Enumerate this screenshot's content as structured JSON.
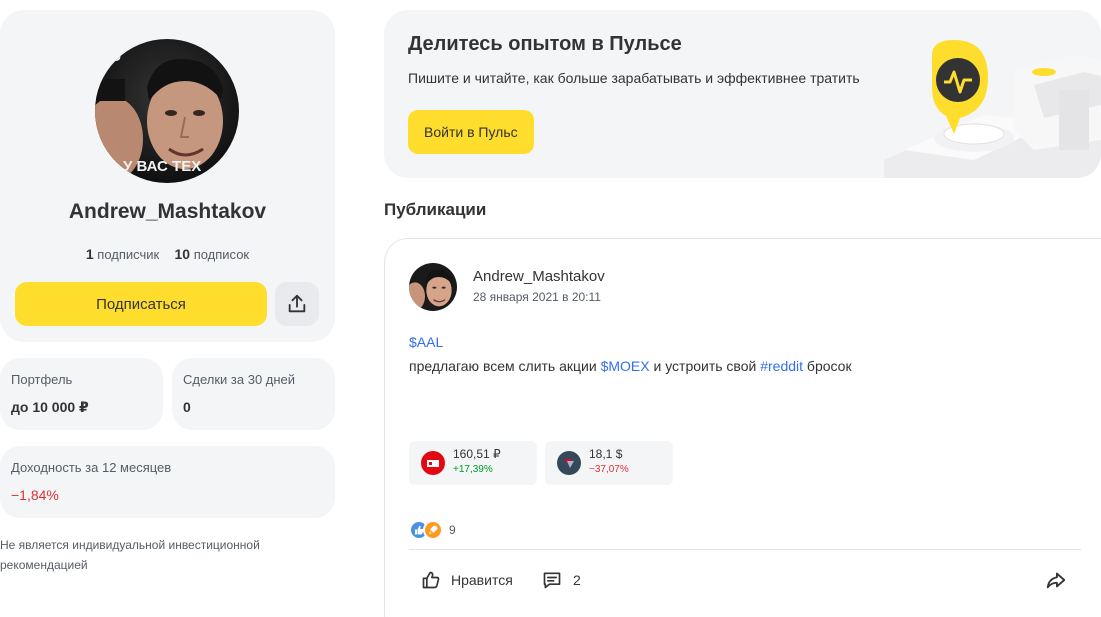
{
  "profile": {
    "username": "Andrew_Mashtakov",
    "avatar_caption": "У ВАС ТЕХ",
    "followers_count": "1",
    "followers_label": "подписчик",
    "following_count": "10",
    "following_label": "подписок",
    "subscribe_label": "Подписаться",
    "share_icon": "share-upload-icon"
  },
  "stats": {
    "portfolio_label": "Портфель",
    "portfolio_value": "до 10 000 ₽",
    "deals_label": "Сделки за 30 дней",
    "deals_value": "0",
    "yield_label": "Доходность за 12 месяцев",
    "yield_value": "−1,84%"
  },
  "disclaimer": "Не является индивидуальной инвестиционной рекомендацией",
  "pulse_banner": {
    "title": "Делитесь опытом в Пульсе",
    "subtitle": "Пишите и читайте, как больше зарабатывать и эффективнее тратить",
    "button_label": "Войти в Пульс"
  },
  "publications_title": "Публикации",
  "post": {
    "author": "Andrew_Mashtakov",
    "date": "28 января 2021 в 20:11",
    "line1_tag": "$AAL",
    "line2_text1": "предлагаю всем слить акции ",
    "line2_tag1": "$MOEX",
    "line2_text2": " и устроить свой ",
    "line2_tag2": "#reddit",
    "line2_text3": " бросок",
    "tickers": [
      {
        "price": "160,51 ₽",
        "change": "+17,39%",
        "direction": "up",
        "logo_color": "#e30613"
      },
      {
        "price": "18,1 $",
        "change": "−37,07%",
        "direction": "down",
        "logo_color": "#36495a"
      }
    ],
    "reactions_count": "9",
    "like_label": "Нравится",
    "comments_count": "2"
  },
  "colors": {
    "accent_yellow": "#ffdd2d",
    "link_blue": "#336fee",
    "positive_green": "#009b2a",
    "negative_red": "#dd3333",
    "card_gray": "#f4f5f7"
  }
}
